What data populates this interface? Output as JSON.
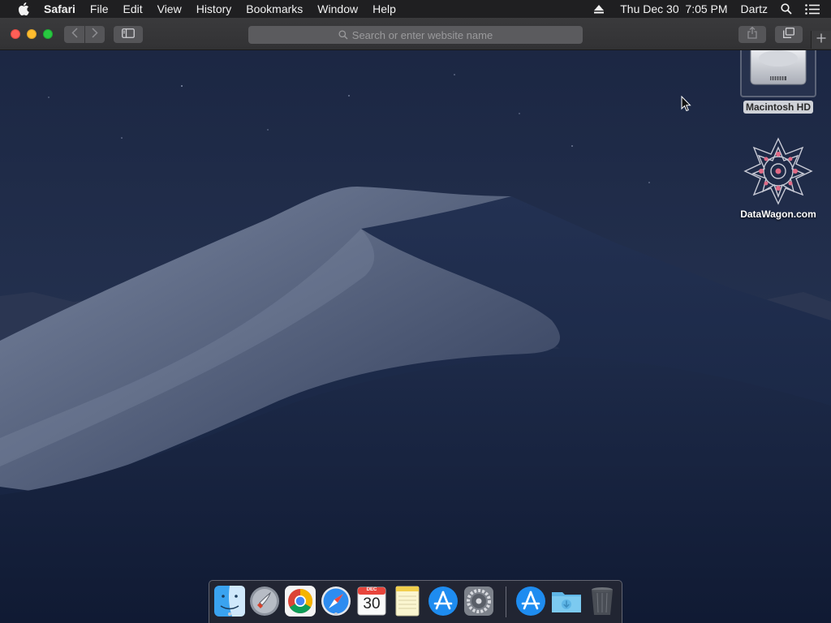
{
  "menubar": {
    "apple_icon": "apple-icon",
    "app_name": "Safari",
    "items": [
      "File",
      "Edit",
      "View",
      "History",
      "Bookmarks",
      "Window",
      "Help"
    ],
    "clock": "Thu Dec 30  7:05 PM",
    "user": "Dartz",
    "status_icons": [
      "eject-icon",
      "spotlight-search-icon",
      "notification-center-icon"
    ]
  },
  "toolbar": {
    "address_placeholder": "Search or enter website name",
    "buttons": [
      "back-icon",
      "forward-icon",
      "sidebar-icon",
      "share-icon",
      "tabs-overview-icon",
      "new-tab-icon"
    ]
  },
  "desktop": {
    "icons": [
      {
        "label": "Macintosh HD",
        "icon": "hard-drive-icon"
      },
      {
        "label": "DataWagon.com",
        "icon": "datawagon-logo-icon"
      }
    ]
  },
  "dock": {
    "calendar_month": "DEC",
    "calendar_day": "30",
    "apps": [
      "Finder",
      "Launchpad",
      "Google Chrome",
      "Safari",
      "Calendar",
      "Notes",
      "App Store",
      "System Preferences"
    ],
    "others": [
      "App Store",
      "Downloads",
      "Trash"
    ],
    "running": [
      "Finder",
      "Safari"
    ]
  },
  "colors": {
    "menubar_bg": "#1f1f21",
    "toolbar_bg": "#363638",
    "wallpaper_sky": "#1b2744",
    "wallpaper_dune": "#3f4c6a",
    "close": "#fd5f57",
    "minimize": "#febc2e",
    "maximize": "#28c840"
  }
}
